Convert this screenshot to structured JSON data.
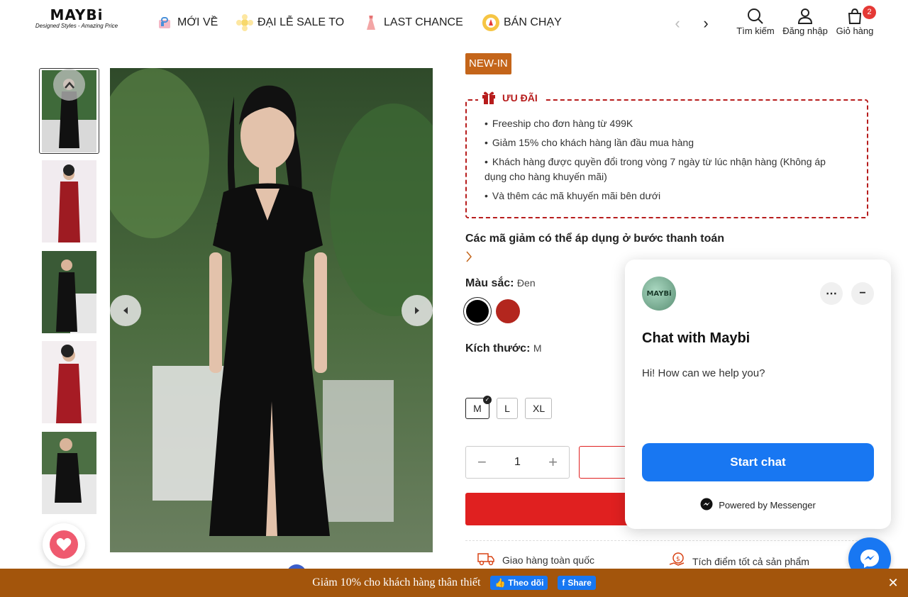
{
  "header": {
    "logo_text": "MAYBi",
    "logo_tagline": "Designed Styles - Amazing Price",
    "nav": [
      {
        "label": "MỚI VỀ",
        "icon": "shopping-bag-icon"
      },
      {
        "label": "ĐẠI LỄ SALE TO",
        "icon": "sale-flower-icon"
      },
      {
        "label": "LAST CHANCE",
        "icon": "dress-icon"
      },
      {
        "label": "BÁN CHẠY",
        "icon": "bestseller-badge-icon"
      }
    ],
    "actions": {
      "search": "Tìm kiếm",
      "login": "Đăng nhập",
      "cart": "Giỏ hàng",
      "cart_count": "2"
    }
  },
  "gallery": {
    "thumbnails": [
      {
        "color": "black",
        "selected": true
      },
      {
        "color": "red",
        "selected": false
      },
      {
        "color": "black",
        "selected": false
      },
      {
        "color": "red",
        "selected": false
      },
      {
        "color": "black",
        "selected": false
      }
    ]
  },
  "product": {
    "badge": "NEW-IN",
    "promo": {
      "title": "ƯU ĐÃI",
      "items": [
        "Freeship cho đơn hàng từ 499K",
        "Giảm 15% cho khách hàng lần đầu mua hàng",
        "Khách hàng được quyền đổi trong vòng 7 ngày từ lúc nhận hàng (Không áp dụng cho hàng khuyến mãi)",
        "Và thêm các mã khuyến mãi bên dưới"
      ]
    },
    "coupon_title": "Các mã giảm có thể áp dụng ở bước thanh toán",
    "color_label": "Màu sắc:",
    "color_value": "Đen",
    "colors": [
      "#000000",
      "#b3261e"
    ],
    "size_label": "Kích thước:",
    "size_value": "M",
    "sizes": [
      "M",
      "L",
      "XL"
    ],
    "selected_size": "M",
    "quantity": "1",
    "features": [
      {
        "label": "Giao hàng toàn quốc",
        "icon": "delivery-truck-icon"
      },
      {
        "label": "Tích điểm tốt cả sản phẩm",
        "icon": "reward-points-icon"
      }
    ]
  },
  "chat": {
    "avatar_text": "MAYBi",
    "title": "Chat with Maybi",
    "subtitle": "Hi! How can we help you?",
    "start_label": "Start chat",
    "powered": "Powered by Messenger"
  },
  "bottom_bar": {
    "text": "Giảm 10% cho khách hàng thân thiết",
    "follow_label": "Theo dõi",
    "share_label": "Share"
  },
  "colors": {
    "accent": "#c4651a",
    "promo_red": "#b71c1c",
    "cta_red": "#e02020",
    "messenger_blue": "#1877f2",
    "bottom_bar": "#a3550c"
  }
}
